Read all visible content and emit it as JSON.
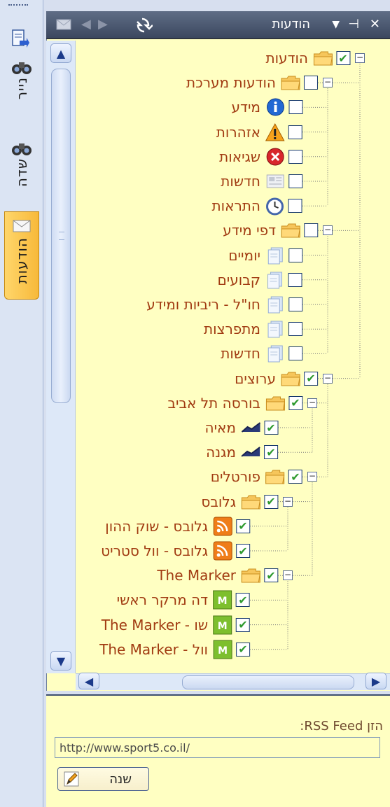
{
  "sidebar": {
    "tabs": [
      {
        "label": "נייר",
        "icon": "binoculars-icon"
      },
      {
        "label": "שדה",
        "icon": "binoculars-icon"
      },
      {
        "label": "הודעות",
        "icon": "envelope-icon",
        "active": true
      }
    ]
  },
  "panel": {
    "title": "הודעות",
    "controls": [
      "close-icon",
      "pin-icon",
      "dropdown-icon"
    ]
  },
  "tree": {
    "nodes": [
      {
        "label": "הודעות",
        "icon": "folder-icon",
        "checked": true,
        "level": 0,
        "exp": "-"
      },
      {
        "label": "הודעות מערכת",
        "icon": "folder-icon",
        "checked": false,
        "level": 1,
        "exp": "-"
      },
      {
        "label": "מידע",
        "icon": "info-icon",
        "checked": false,
        "level": 2
      },
      {
        "label": "אזהרות",
        "icon": "warning-icon",
        "checked": false,
        "level": 2
      },
      {
        "label": "שגיאות",
        "icon": "error-icon",
        "checked": false,
        "level": 2
      },
      {
        "label": "חדשות",
        "icon": "news-icon",
        "checked": false,
        "level": 2
      },
      {
        "label": "התראות",
        "icon": "alarm-clock-icon",
        "checked": false,
        "level": 2
      },
      {
        "label": "דפי מידע",
        "icon": "folder-icon",
        "checked": false,
        "level": 1,
        "exp": "-"
      },
      {
        "label": "יומיים",
        "icon": "pages-icon",
        "checked": false,
        "level": 2
      },
      {
        "label": "קבועים",
        "icon": "pages-icon",
        "checked": false,
        "level": 2
      },
      {
        "label": "חו\"ל - ריביות ומידע",
        "icon": "pages-icon",
        "checked": false,
        "level": 2
      },
      {
        "label": "מתפרצות",
        "icon": "pages-icon",
        "checked": false,
        "level": 2
      },
      {
        "label": "חדשות",
        "icon": "pages-icon",
        "checked": false,
        "level": 2
      },
      {
        "label": "ערוצים",
        "icon": "folder-icon",
        "checked": true,
        "level": 1,
        "exp": "-"
      },
      {
        "label": "בורסה תל אביב",
        "icon": "folder-icon",
        "checked": true,
        "level": 2,
        "exp": "-"
      },
      {
        "label": "מאיה",
        "icon": "chart-line-icon",
        "checked": true,
        "level": 3
      },
      {
        "label": "מגנה",
        "icon": "chart-line-icon",
        "checked": true,
        "level": 3
      },
      {
        "label": "פורטלים",
        "icon": "folder-icon",
        "checked": true,
        "level": 2,
        "exp": "-"
      },
      {
        "label": "גלובס",
        "icon": "folder-icon",
        "checked": true,
        "level": 3,
        "exp": "-"
      },
      {
        "label": "גלובס - שוק ההון",
        "icon": "rss-icon",
        "checked": true,
        "level": 4
      },
      {
        "label": "גלובס - וול סטריט",
        "icon": "rss-icon",
        "checked": true,
        "level": 4
      },
      {
        "label": "The Marker",
        "icon": "folder-icon",
        "checked": true,
        "level": 3,
        "exp": "-"
      },
      {
        "label": "דה מרקר ראשי",
        "icon": "marker-icon",
        "checked": true,
        "level": 4
      },
      {
        "label": "The Marker - שו",
        "icon": "marker-icon",
        "checked": true,
        "level": 4
      },
      {
        "label": "The Marker - וול",
        "icon": "marker-icon",
        "checked": true,
        "level": 4
      }
    ]
  },
  "rss": {
    "label": "הזן RSS Feed:",
    "url": "http://www.sport5.co.il/",
    "button_label": "שנה"
  },
  "colors": {
    "tree_bg": "#ffffc2",
    "label": "#a13b12",
    "titlebar": "#3b475e",
    "accent": "#f7b93a"
  }
}
